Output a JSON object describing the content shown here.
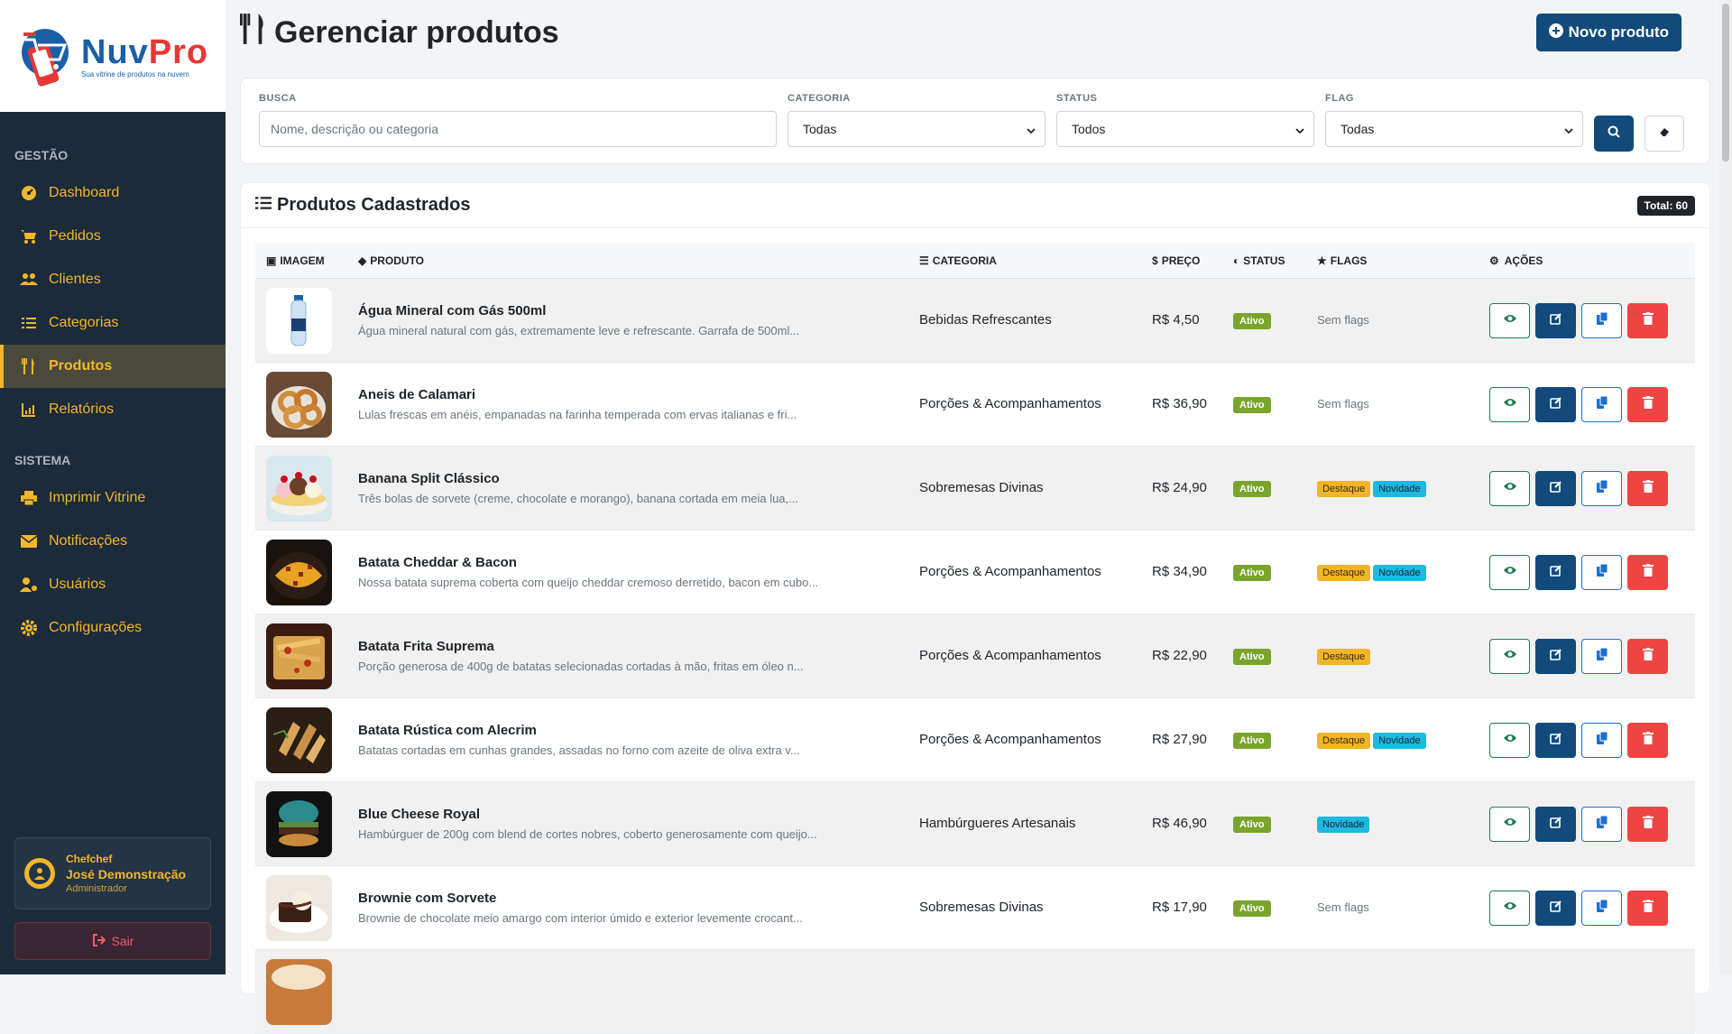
{
  "brand": {
    "name_a": "Nuv",
    "name_b": "Pro",
    "tagline": "Sua vitrine de produtos na nuvem"
  },
  "sidebar": {
    "section1": "GESTÃO",
    "section2": "SISTEMA",
    "items1": [
      {
        "label": "Dashboard",
        "icon": "dashboard-icon"
      },
      {
        "label": "Pedidos",
        "icon": "cart-icon"
      },
      {
        "label": "Clientes",
        "icon": "users-icon"
      },
      {
        "label": "Categorias",
        "icon": "list-icon"
      },
      {
        "label": "Produtos",
        "icon": "utensils-icon",
        "active": true
      },
      {
        "label": "Relatórios",
        "icon": "chart-icon"
      }
    ],
    "items2": [
      {
        "label": "Imprimir Vitrine",
        "icon": "print-icon"
      },
      {
        "label": "Notificações",
        "icon": "envelope-icon"
      },
      {
        "label": "Usuários",
        "icon": "user-cog-icon"
      },
      {
        "label": "Configurações",
        "icon": "gear-icon"
      }
    ],
    "user": {
      "username": "Chefchef",
      "name": "José Demonstração",
      "role": "Administrador"
    },
    "logout": "Sair"
  },
  "header": {
    "title": "Gerenciar produtos",
    "new_button": "Novo produto"
  },
  "filters": {
    "search_label": "BUSCA",
    "search_placeholder": "Nome, descrição ou categoria",
    "category_label": "CATEGORIA",
    "category_value": "Todas",
    "status_label": "STATUS",
    "status_value": "Todos",
    "flag_label": "FLAG",
    "flag_value": "Todas"
  },
  "table": {
    "title": "Produtos Cadastrados",
    "total": "Total: 60",
    "columns": [
      "IMAGEM",
      "PRODUTO",
      "CATEGORIA",
      "PREÇO",
      "STATUS",
      "FLAGS",
      "AÇÕES"
    ],
    "rows": [
      {
        "name": "Água Mineral com Gás 500ml",
        "desc": "Água mineral natural com gás, extremamente leve e refrescante. Garrafa de 500ml...",
        "category": "Bebidas Refrescantes",
        "price": "R$ 4,50",
        "status": "Ativo",
        "flags": [],
        "noflags": "Sem flags",
        "thumb": "water"
      },
      {
        "name": "Aneis de Calamari",
        "desc": "Lulas frescas em anéis, empanadas na farinha temperada com ervas italianas e fri...",
        "category": "Porções & Acompanhamentos",
        "price": "R$ 36,90",
        "status": "Ativo",
        "flags": [],
        "noflags": "Sem flags",
        "thumb": "rings"
      },
      {
        "name": "Banana Split Clássico",
        "desc": "Três bolas de sorvete (creme, chocolate e morango), banana cortada em meia lua,...",
        "category": "Sobremesas Divinas",
        "price": "R$ 24,90",
        "status": "Ativo",
        "flags": [
          "Destaque",
          "Novidade"
        ],
        "noflags": "",
        "thumb": "split"
      },
      {
        "name": "Batata Cheddar & Bacon",
        "desc": "Nossa batata suprema coberta com queijo cheddar cremoso derretido, bacon em cubo...",
        "category": "Porções & Acompanhamentos",
        "price": "R$ 34,90",
        "status": "Ativo",
        "flags": [
          "Destaque",
          "Novidade"
        ],
        "noflags": "",
        "thumb": "cheddar"
      },
      {
        "name": "Batata Frita Suprema",
        "desc": "Porção generosa de 400g de batatas selecionadas cortadas à mão, fritas em óleo n...",
        "category": "Porções & Acompanhamentos",
        "price": "R$ 22,90",
        "status": "Ativo",
        "flags": [
          "Destaque"
        ],
        "noflags": "",
        "thumb": "fries"
      },
      {
        "name": "Batata Rústica com Alecrim",
        "desc": "Batatas cortadas em cunhas grandes, assadas no forno com azeite de oliva extra v...",
        "category": "Porções & Acompanhamentos",
        "price": "R$ 27,90",
        "status": "Ativo",
        "flags": [
          "Destaque",
          "Novidade"
        ],
        "noflags": "",
        "thumb": "rustic"
      },
      {
        "name": "Blue Cheese Royal",
        "desc": "Hambúrguer de 200g com blend de cortes nobres, coberto generosamente com queijo...",
        "category": "Hambúrgueres Artesanais",
        "price": "R$ 46,90",
        "status": "Ativo",
        "flags": [
          "Novidade"
        ],
        "noflags": "",
        "thumb": "burger"
      },
      {
        "name": "Brownie com Sorvete",
        "desc": "Brownie de chocolate meio amargo com interior úmido e exterior levemente crocant...",
        "category": "Sobremesas Divinas",
        "price": "R$ 17,90",
        "status": "Ativo",
        "flags": [],
        "noflags": "Sem flags",
        "thumb": "brownie"
      }
    ]
  },
  "colors": {
    "primary": "#114a7b",
    "accent": "#f2b62a",
    "sidebar": "#1c2b3a",
    "success": "#7aa52d",
    "danger": "#ef4444",
    "info": "#1fb8e0"
  }
}
